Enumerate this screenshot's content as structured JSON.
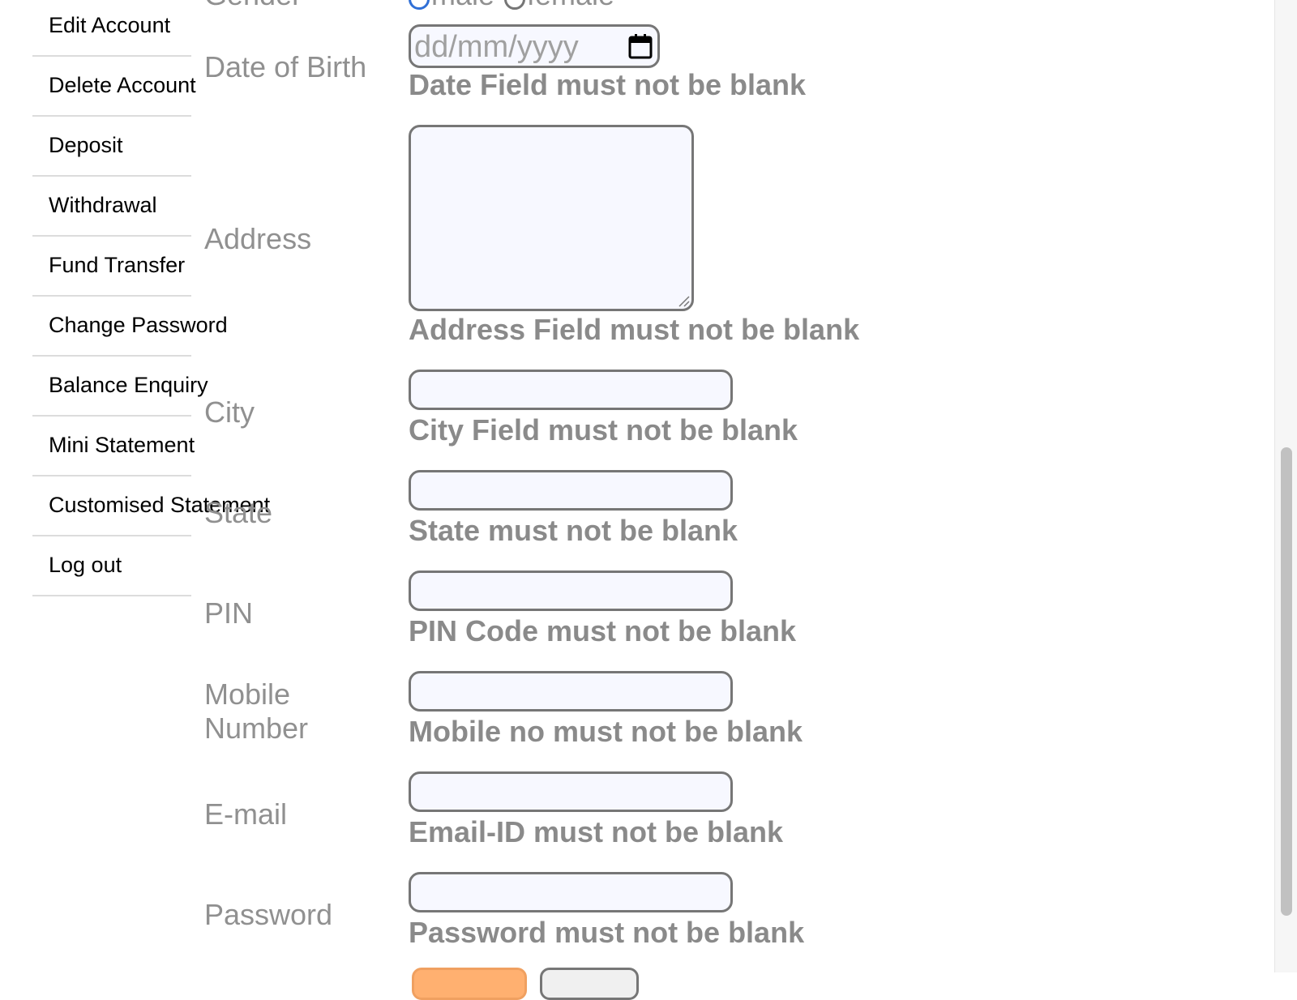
{
  "menu": {
    "items": [
      {
        "label": "Edit Account"
      },
      {
        "label": "Delete Account"
      },
      {
        "label": "Deposit"
      },
      {
        "label": "Withdrawal"
      },
      {
        "label": "Fund Transfer"
      },
      {
        "label": "Change Password"
      },
      {
        "label": "Balance Enquiry"
      },
      {
        "label": "Mini Statement"
      },
      {
        "label": "Customised Statement"
      },
      {
        "label": "Log out"
      }
    ]
  },
  "form": {
    "gender": {
      "label": "Gender",
      "options": [
        "male",
        "female"
      ],
      "selected": "male"
    },
    "dob": {
      "label": "Date of Birth",
      "placeholder": "dd/mm/yyyy",
      "error": "Date Field must not be blank"
    },
    "address": {
      "label": "Address",
      "value": "",
      "error": "Address Field must not be blank"
    },
    "city": {
      "label": "City",
      "value": "",
      "error": "City Field must not be blank"
    },
    "state": {
      "label": "State",
      "value": "",
      "error": "State must not be blank"
    },
    "pin": {
      "label": "PIN",
      "value": "",
      "error": "PIN Code must not be blank"
    },
    "mobile": {
      "label": "Mobile Number",
      "value": "",
      "error": "Mobile no must not be blank"
    },
    "email": {
      "label": "E-mail",
      "value": "",
      "error": "Email-ID must not be blank"
    },
    "password": {
      "label": "Password",
      "value": "",
      "error": "Password must not be blank"
    }
  },
  "colors": {
    "label": "#909090",
    "error": "#8a8a8a",
    "input_bg": "#f7f8ff",
    "submit_accent": "#ffb070"
  },
  "icons": {
    "calendar": "calendar-icon",
    "resize": "resize-handle-icon"
  }
}
